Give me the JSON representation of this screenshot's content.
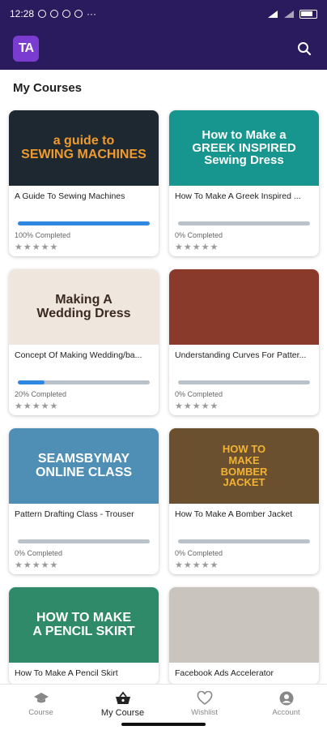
{
  "status_bar": {
    "time": "12:28",
    "notif_icons": [
      "icon-a",
      "whatsapp-icon",
      "whatsapp-icon",
      "icon-b"
    ],
    "more": "···",
    "battery": "89"
  },
  "app_bar": {
    "logo_text": "TA"
  },
  "page": {
    "title": "My Courses"
  },
  "courses": [
    {
      "title": "A Guide To Sewing Machines",
      "progress": 100,
      "progress_label": "100% Completed",
      "thumb_text": "a guide to\nSEWING MACHINES",
      "thumb_bg": "#1e2830",
      "thumb_fg": "#f09a2e"
    },
    {
      "title": "How To Make A Greek Inspired ...",
      "progress": 0,
      "progress_label": "0% Completed",
      "thumb_text": "How to Make a\nGREEK INSPIRED\nSewing Dress",
      "thumb_bg": "#17958f",
      "thumb_fg": "#ffffff"
    },
    {
      "title": "Concept Of Making Wedding/ba...",
      "progress": 20,
      "progress_label": "20% Completed",
      "thumb_text": "Making A\nWedding Dress",
      "thumb_bg": "#efe6de",
      "thumb_fg": "#3a2a20"
    },
    {
      "title": "Understanding Curves For Patter...",
      "progress": 0,
      "progress_label": "0% Completed",
      "thumb_text": "",
      "thumb_bg": "#8a3a2a",
      "thumb_fg": "#ffffff"
    },
    {
      "title": "Pattern Drafting Class - Trouser",
      "progress": 0,
      "progress_label": "0% Completed",
      "thumb_text": "SEAMSBYMAY\nONLINE CLASS",
      "thumb_bg": "#4f8fb5",
      "thumb_fg": "#ffffff"
    },
    {
      "title": "How To Make A Bomber Jacket",
      "progress": 0,
      "progress_label": "0% Completed",
      "thumb_text": "HOW TO\nMAKE\nBOMBER\nJACKET",
      "thumb_bg": "#6b5030",
      "thumb_fg": "#f2b233"
    },
    {
      "title": "How To Make A Pencil Skirt",
      "progress": null,
      "progress_label": "",
      "thumb_text": "HOW TO MAKE\nA PENCIL SKIRT",
      "thumb_bg": "#2f8a6a",
      "thumb_fg": "#ffffff"
    },
    {
      "title": "Facebook Ads Accelerator",
      "progress": null,
      "progress_label": "",
      "thumb_text": "",
      "thumb_bg": "#c9c4bd",
      "thumb_fg": "#333333"
    }
  ],
  "nav": [
    {
      "label": "Course",
      "icon": "graduation-cap-icon",
      "active": false
    },
    {
      "label": "My Course",
      "icon": "basket-icon",
      "active": true
    },
    {
      "label": "Wishlist",
      "icon": "heart-icon",
      "active": false
    },
    {
      "label": "Account",
      "icon": "account-icon",
      "active": false
    }
  ],
  "colors": {
    "brand": "#2a1a5e",
    "progress": "#2f87e0",
    "track": "#b9c2c8"
  }
}
